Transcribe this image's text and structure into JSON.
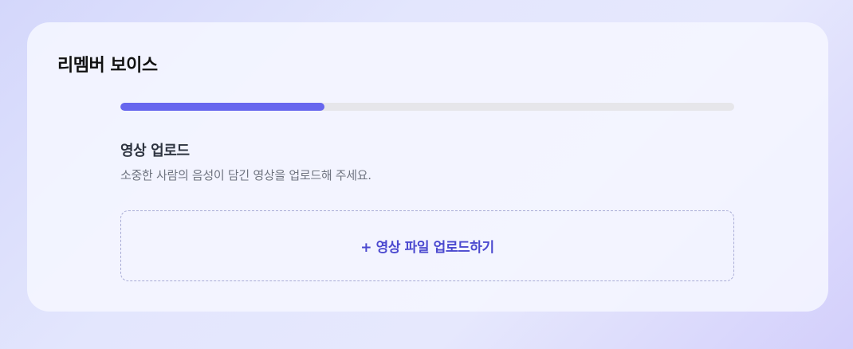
{
  "app": {
    "title": "리멤버 보이스"
  },
  "progress": {
    "value": 0.333
  },
  "step": {
    "title": "영상 업로드",
    "description": "소중한 사람의 음성이 담긴 영상을 업로드해 주세요."
  },
  "upload": {
    "label": "+ 영상 파일 업로드하기"
  },
  "colors": {
    "accent": "#6766ee",
    "upload_text": "#4b49cf",
    "track": "#e6e6ea"
  }
}
